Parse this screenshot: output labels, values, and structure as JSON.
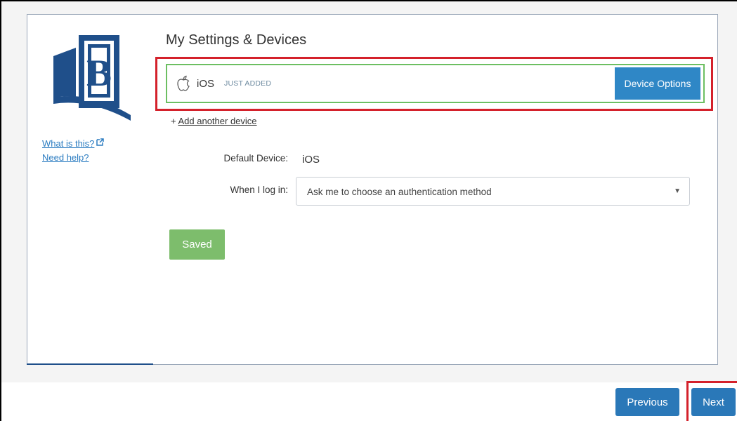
{
  "page": {
    "title": "My Settings & Devices"
  },
  "sidebar": {
    "logo_icon": "university-book-logo",
    "what_is_this": "What is this?",
    "need_help": "Need help?"
  },
  "device": {
    "icon": "apple-icon",
    "name": "iOS",
    "badge": "JUST ADDED",
    "options_label": "Device Options"
  },
  "add_device": {
    "prefix": "+ ",
    "link_label": "Add another device"
  },
  "settings": {
    "default_device_label": "Default Device:",
    "default_device_value": "iOS",
    "login_label": "When I log in:",
    "login_selected": "Ask me to choose an authentication method"
  },
  "saved_label": "Saved",
  "footer": {
    "previous_label": "Previous",
    "next_label": "Next"
  },
  "colors": {
    "primary": "#2f87c6",
    "success": "#7dbd6c",
    "device_border": "#6cbf62",
    "annotation": "#d4212b",
    "link": "#2b7cc1"
  }
}
